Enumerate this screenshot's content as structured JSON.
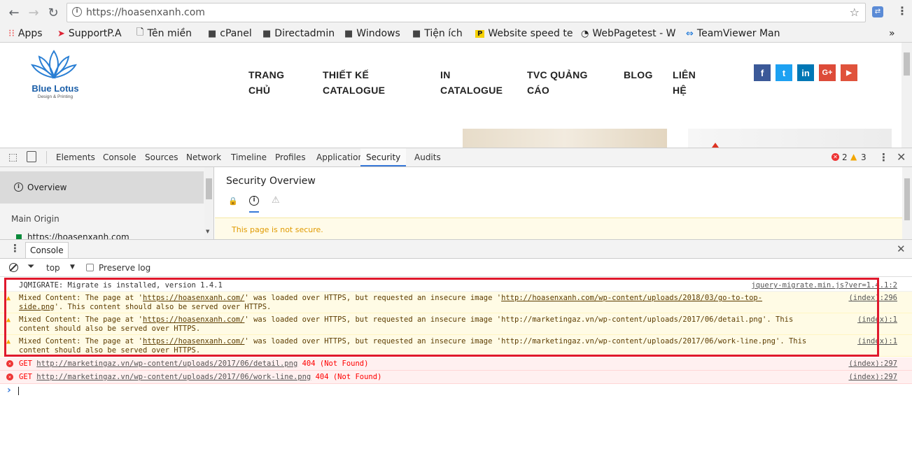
{
  "browser": {
    "url": "https://hoasenxanh.com",
    "bookmarks": [
      {
        "label": "Apps",
        "icon": "apps-grid-icon"
      },
      {
        "label": "SupportP.A",
        "icon": "support-icon"
      },
      {
        "label": "Tên miền",
        "icon": "page-icon"
      },
      {
        "label": "cPanel",
        "icon": "folder-icon"
      },
      {
        "label": "Directadmin",
        "icon": "folder-icon"
      },
      {
        "label": "Windows",
        "icon": "folder-icon"
      },
      {
        "label": "Tiện ích",
        "icon": "folder-icon"
      },
      {
        "label": "Website speed te",
        "icon": "pagespeed-icon"
      },
      {
        "label": "WebPagetest - W",
        "icon": "gauge-icon"
      },
      {
        "label": "TeamViewer Man",
        "icon": "teamviewer-icon"
      }
    ],
    "more": "»"
  },
  "site": {
    "logo_name": "Blue Lotus",
    "logo_tagline": "Design & Printing",
    "nav": [
      {
        "line1": "TRANG",
        "line2": "CHỦ"
      },
      {
        "line1": "THIẾT KẾ",
        "line2": "CATALOGUE"
      },
      {
        "line1": "IN",
        "line2": "CATALOGUE"
      },
      {
        "line1": "TVC QUẢNG",
        "line2": "CÁO"
      },
      {
        "line1": "BLOG",
        "line2": ""
      },
      {
        "line1": "LIÊN",
        "line2": "HỆ"
      }
    ],
    "social": [
      {
        "label": "f",
        "color": "#3b5998",
        "icon": "facebook-icon"
      },
      {
        "label": "t",
        "color": "#1da1f2",
        "icon": "twitter-icon"
      },
      {
        "label": "in",
        "color": "#0077b5",
        "icon": "linkedin-icon"
      },
      {
        "label": "G+",
        "color": "#dd4b39",
        "icon": "google-plus-icon"
      },
      {
        "label": "▶",
        "color": "#e0533c",
        "icon": "youtube-icon"
      }
    ]
  },
  "devtools": {
    "tabs": [
      "Elements",
      "Console",
      "Sources",
      "Network",
      "Timeline",
      "Profiles",
      "Application",
      "Security",
      "Audits"
    ],
    "active_tab": "Security",
    "error_count": "2",
    "warning_count": "3",
    "security": {
      "overview_label": "Overview",
      "main_origin_label": "Main Origin",
      "origin_url": "https://hoasenxanh.com",
      "title": "Security Overview",
      "status": "This page is not secure."
    },
    "console": {
      "tab_label": "Console",
      "context": "top",
      "preserve_log": "Preserve log",
      "messages": [
        {
          "type": "log",
          "text": "JQMIGRATE: Migrate is installed, version 1.4.1",
          "source": "jquery-migrate.min.js?ver=1.4.1:2"
        },
        {
          "type": "warn",
          "pre": "Mixed Content: The page at '",
          "link1": "https://hoasenxanh.com/",
          "mid": "' was loaded over HTTPS, but requested an insecure image '",
          "link2": "http://hoasenxanh.com/wp-content/uploads/2018/03/go-to-top-",
          "link2b": "side.png",
          "post": "'. This content should also be served over HTTPS.",
          "source": "(index):296"
        },
        {
          "type": "warn",
          "pre": "Mixed Content: The page at '",
          "link1": "https://hoasenxanh.com/",
          "mid": "' was loaded over HTTPS, but requested an insecure image 'http://marketingaz.vn/wp-content/uploads/2017/06/detail.png'. This",
          "post": "content should also be served over HTTPS.",
          "source": "(index):1"
        },
        {
          "type": "warn",
          "pre": "Mixed Content: The page at '",
          "link1": "https://hoasenxanh.com/",
          "mid": "' was loaded over HTTPS, but requested an insecure image 'http://marketingaz.vn/wp-content/uploads/2017/06/work-line.png'. This",
          "post": "content should also be served over HTTPS.",
          "source": "(index):1"
        },
        {
          "type": "error",
          "method": "GET",
          "url": "http://marketingaz.vn/wp-content/uploads/2017/06/detail.png",
          "status": "404 (Not Found)",
          "source": "(index):297"
        },
        {
          "type": "error",
          "method": "GET",
          "url": "http://marketingaz.vn/wp-content/uploads/2017/06/work-line.png",
          "status": "404 (Not Found)",
          "source": "(index):297"
        }
      ],
      "prompt": "›"
    }
  }
}
